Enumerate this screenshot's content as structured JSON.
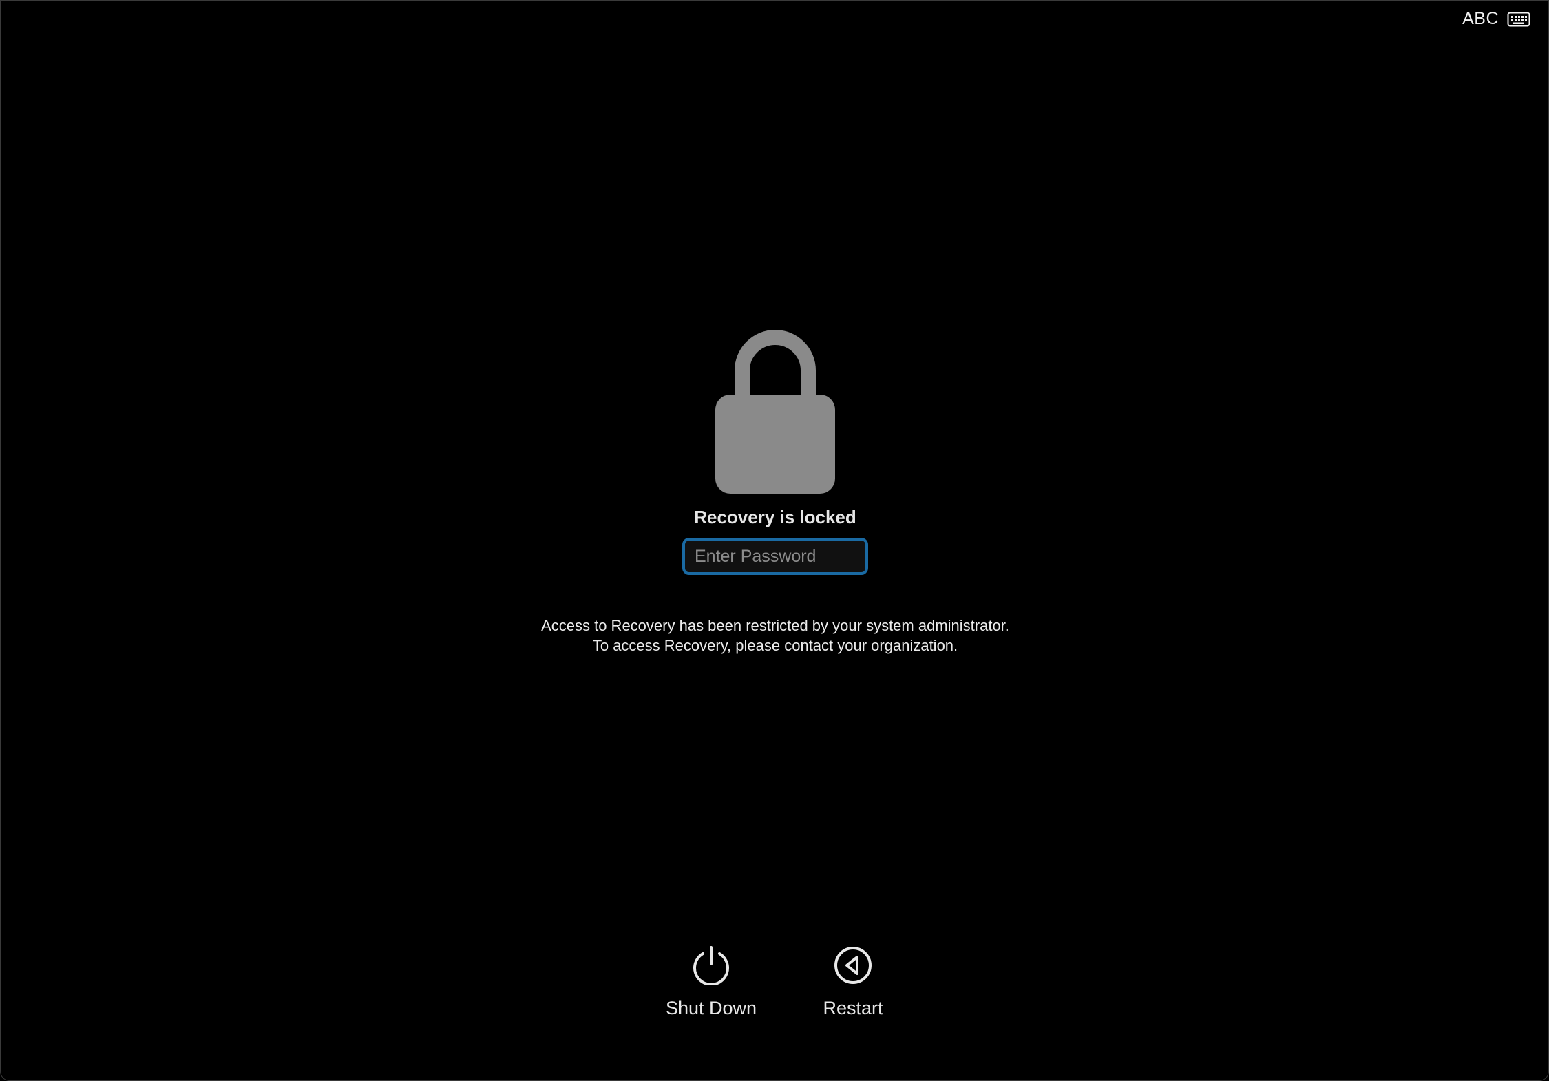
{
  "input_menu": {
    "label": "ABC",
    "icon": "keyboard-icon"
  },
  "lock": {
    "icon": "lock-icon",
    "color": "#8a8a8a"
  },
  "title": "Recovery is locked",
  "password": {
    "placeholder": "Enter Password",
    "value": "",
    "focus_color": "#1a6aa3"
  },
  "message": {
    "line1": "Access to Recovery has been restricted by your system administrator.",
    "line2": "To access Recovery, please contact your organization."
  },
  "actions": {
    "shutdown": {
      "label": "Shut Down",
      "icon": "power-icon"
    },
    "restart": {
      "label": "Restart",
      "icon": "restart-icon"
    }
  }
}
